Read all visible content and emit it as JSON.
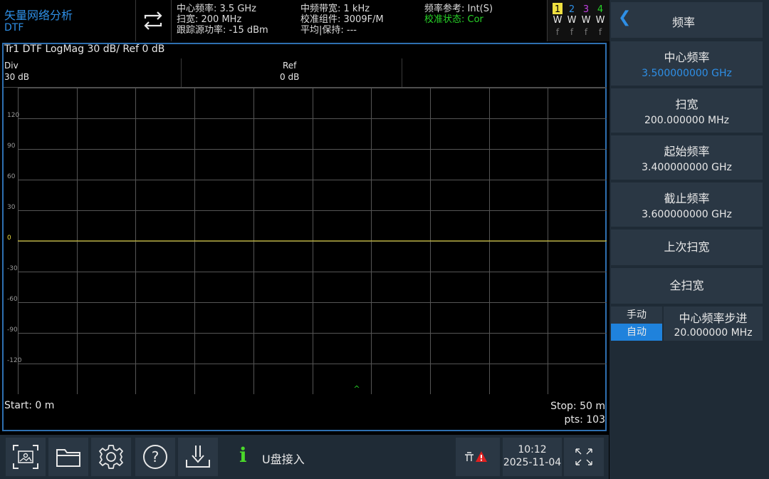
{
  "mode": {
    "title": "矢量网络分析",
    "subtitle": "DTF"
  },
  "status_info": {
    "col1": [
      "中心频率: 3.5 GHz",
      "扫宽: 200 MHz",
      "跟踪源功率: -15 dBm"
    ],
    "col2": [
      "中频带宽: 1 kHz",
      "校准组件: 3009F/M",
      "平均|保持: ---"
    ],
    "col3": [
      "频率参考: Int(S)",
      "校准状态: Cor"
    ]
  },
  "traces": [
    {
      "num": "1",
      "w": "W",
      "f": "f",
      "color": "#f0e040"
    },
    {
      "num": "2",
      "w": "W",
      "f": "f",
      "color": "#2e8fe6"
    },
    {
      "num": "3",
      "w": "W",
      "f": "f",
      "color": "#c040e0"
    },
    {
      "num": "4",
      "w": "W",
      "f": "f",
      "color": "#27d327"
    }
  ],
  "plot": {
    "header": "Tr1 DTF LogMag 30 dB/ Ref 0 dB",
    "div_label": "Div",
    "div_value": "30 dB",
    "ref_label": "Ref",
    "ref_value": "0 dB",
    "start": "Start: 0 m",
    "stop": "Stop: 50 m",
    "pts": "pts: 103",
    "marker_symbol": "^"
  },
  "chart_data": {
    "type": "line",
    "y_ticks": [
      "120",
      "90",
      "60",
      "30",
      "0",
      "-30",
      "-60",
      "-90",
      "-120"
    ],
    "ylim": [
      -150,
      150
    ],
    "xlim": [
      0,
      50
    ],
    "grid": true,
    "series": [
      {
        "x": [
          0,
          50
        ],
        "y": [
          0,
          0
        ],
        "color": "#f0e040"
      }
    ]
  },
  "panel": {
    "title": "频率",
    "buttons": [
      {
        "label": "中心频率",
        "value": "3.500000000 GHz",
        "active": true
      },
      {
        "label": "扫宽",
        "value": "200.000000 MHz"
      },
      {
        "label": "起始频率",
        "value": "3.400000000 GHz"
      },
      {
        "label": "截止频率",
        "value": "3.600000000 GHz"
      },
      {
        "label": "上次扫宽",
        "value": ""
      },
      {
        "label": "全扫宽",
        "value": ""
      }
    ],
    "step": {
      "manual": "手动",
      "auto": "自动",
      "label": "中心频率步进",
      "value": "20.000000 MHz"
    }
  },
  "toolbar": {
    "message": "U盘接入",
    "time": "10:12",
    "date": "2025-11-04"
  },
  "colors": {
    "accent": "#2e8fe6",
    "cor_status": "#27d327",
    "trace1": "#f0e040",
    "warning": "#e02020"
  }
}
